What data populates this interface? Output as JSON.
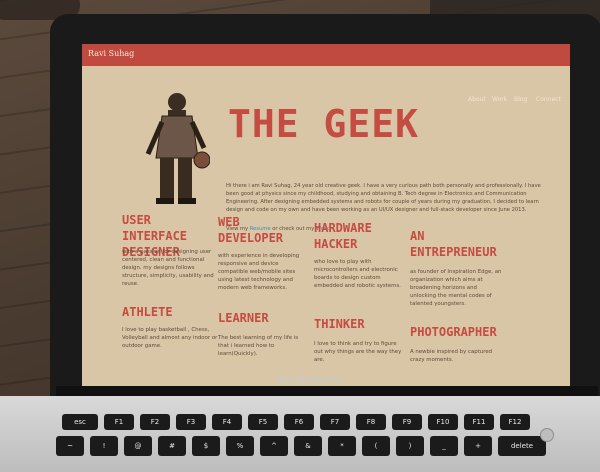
{
  "site": {
    "brand": "Ravi Suhag",
    "nav": [
      "About",
      "Work",
      "Blog",
      "Connect"
    ],
    "title": "THE GEEK",
    "intro": "Hi there i am Ravi Suhag, 24 year old creative geek. I have a very curious path both personally and professionally. I have been good at physics since my childhood, studying and obtaining B. Tech degree in Electronics and Communication Engineering. After designing embedded systems and robots for couple of years during my graduation, I decided to learn design and code on my own and have been working as an UI/UX designer and full-stack developer since June 2013.",
    "cv_prefix": "View my",
    "cv_link1": "Resume",
    "cv_mid": "or check out my",
    "cv_link2": "Work",
    "skills": [
      {
        "title": "USER INTERFACE DESIGNER",
        "desc": "with a passion for designing user centered, clean and functional design. my designs follows structure, simplicity, usability and reuse."
      },
      {
        "title": "WEB DEVELOPER",
        "desc": "with experience in developing responsive and device compatible web/mobile sites using latest technology and modern web frameworks."
      },
      {
        "title": "HARDWARE HACKER",
        "desc": "who love to play with microcontrollers and electronic boards to design custom embedded and robotic systems."
      },
      {
        "title": "AN ENTREPRENEUR",
        "desc": "as founder of Inspiration Edge, an organization which aims at broadening horizons and unlocking the mental codes of talented youngsters."
      },
      {
        "title": "ATHLETE",
        "desc": "I love to play basketball , Chess, Volleyball and almost any indoor or outdoor game."
      },
      {
        "title": "LEARNER",
        "desc": "The best learning of my life is that i learned how to learn(Quickly)."
      },
      {
        "title": "THINKER",
        "desc": "I love to think and try to figure out why things are the way they are."
      },
      {
        "title": "PHOTOGRAPHER",
        "desc": "A newbie inspired by captured crazy moments."
      }
    ]
  },
  "laptop_label": "MacBook Pro",
  "keys": {
    "row1": [
      "esc",
      "F1",
      "F2",
      "F3",
      "F4",
      "F5",
      "F6",
      "F7",
      "F8",
      "F9",
      "F10",
      "F11",
      "F12"
    ],
    "row2": [
      "~",
      "!",
      "@",
      "#",
      "$",
      "%",
      "^",
      "&",
      "*",
      "(",
      ")",
      "_",
      "+",
      "delete"
    ]
  }
}
